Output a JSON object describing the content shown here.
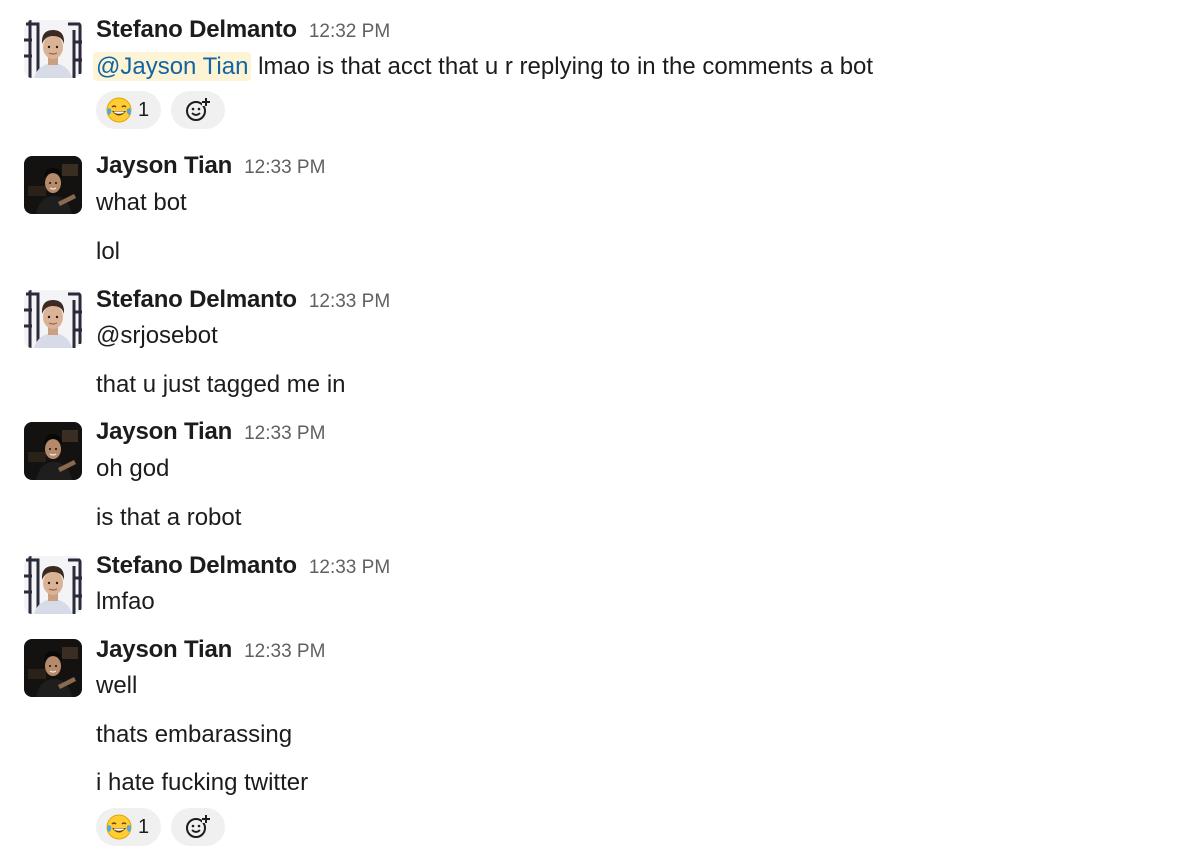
{
  "messages": [
    {
      "author": "Stefano Delmanto",
      "time": "12:32 PM",
      "avatar": "stefano-avatar",
      "lines": [
        {
          "mention": "@Jayson Tian",
          "text": " lmao is that acct that u r replying to in the comments a bot"
        }
      ],
      "reactions": [
        {
          "emoji": "face-with-tears-of-joy-icon",
          "count": "1"
        }
      ]
    },
    {
      "author": "Jayson Tian",
      "time": "12:33 PM",
      "avatar": "jayson-avatar",
      "lines": [
        {
          "text": "what bot"
        },
        {
          "text": "lol"
        }
      ]
    },
    {
      "author": "Stefano Delmanto",
      "time": "12:33 PM",
      "avatar": "stefano-avatar",
      "lines": [
        {
          "text": "@srjosebot"
        },
        {
          "text": "that u just tagged me in"
        }
      ]
    },
    {
      "author": "Jayson Tian",
      "time": "12:33 PM",
      "avatar": "jayson-avatar",
      "lines": [
        {
          "text": "oh god"
        },
        {
          "text": "is that a robot"
        }
      ]
    },
    {
      "author": "Stefano Delmanto",
      "time": "12:33 PM",
      "avatar": "stefano-avatar",
      "lines": [
        {
          "text": "lmfao"
        }
      ]
    },
    {
      "author": "Jayson Tian",
      "time": "12:33 PM",
      "avatar": "jayson-avatar",
      "lines": [
        {
          "text": "well"
        },
        {
          "text": "thats embarassing"
        },
        {
          "text": "i hate fucking twitter"
        }
      ],
      "reactions": [
        {
          "emoji": "face-with-tears-of-joy-icon",
          "count": "1"
        }
      ]
    }
  ],
  "colors": {
    "mention_bg": "#fcf4d4",
    "mention_text": "#1264a3",
    "reaction_bg": "#f0f0f0",
    "timestamp": "#616061"
  },
  "icons": {
    "add_reaction": "add-reaction-icon"
  }
}
